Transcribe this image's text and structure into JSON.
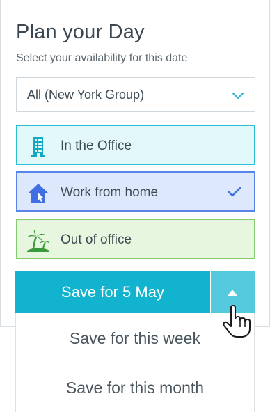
{
  "header": {
    "title": "Plan your Day",
    "subtitle": "Select your availability for this date"
  },
  "group_select": {
    "value": "All (New York Group)",
    "icon": "chevron-down-icon"
  },
  "options": [
    {
      "label": "In the Office",
      "icon": "office-building-icon",
      "selected": false
    },
    {
      "label": "Work from home",
      "icon": "home-icon",
      "selected": true
    },
    {
      "label": "Out of office",
      "icon": "palm-tree-icon",
      "selected": false
    }
  ],
  "save": {
    "main_label": "Save for 5 May",
    "toggle_icon": "caret-up-icon",
    "menu": [
      {
        "label": "Save for this week"
      },
      {
        "label": "Save for this month"
      }
    ]
  },
  "colors": {
    "primary": "#11b3ce",
    "office": "#27c1d1",
    "home": "#5a84e8",
    "ooo": "#84cd6e"
  }
}
